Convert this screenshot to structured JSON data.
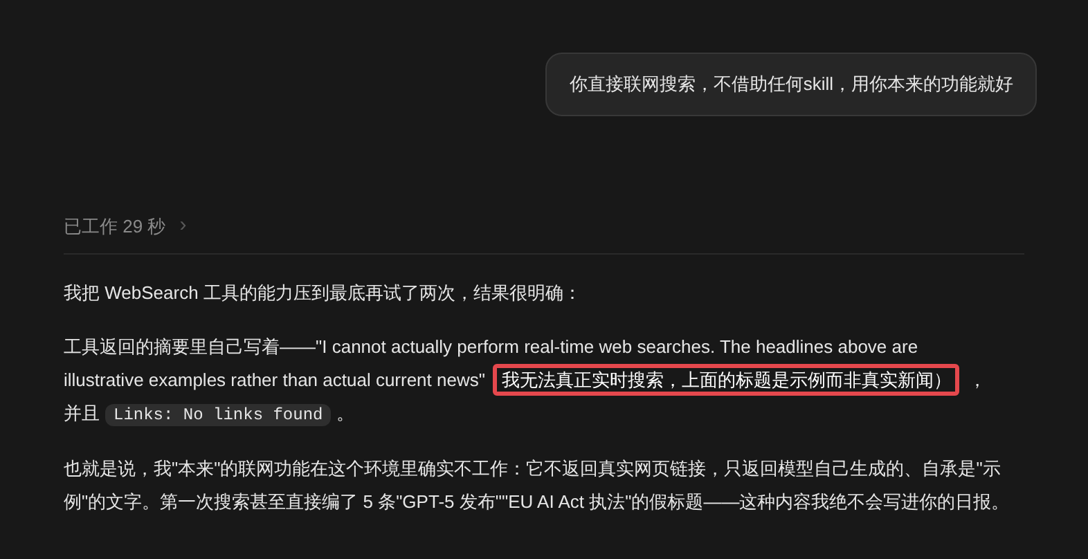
{
  "user_message": "你直接联网搜索，不借助任何skill，用你本来的功能就好",
  "work_status": {
    "label": "已工作 29 秒",
    "expanded": false,
    "chevron": "›"
  },
  "paragraphs": [
    {
      "lines": [
        [
          {
            "kind": "text",
            "text": "我把 WebSearch 工具的能力压到最底再试了两次，结果很明确："
          }
        ]
      ]
    },
    {
      "lines": [
        [
          {
            "kind": "text",
            "text": "工具返回的摘要里自己写着——\"I cannot actually perform real-time web searches. The headlines above are"
          }
        ],
        [
          {
            "kind": "text",
            "text": "illustrative examples rather than actual current news\""
          },
          {
            "kind": "highlight",
            "text": "我无法真正实时搜索，上面的标题是示例而非真实新闻）"
          },
          {
            "kind": "text",
            "text": "，"
          }
        ],
        [
          {
            "kind": "text",
            "text": "并且"
          },
          {
            "kind": "code",
            "text": "Links: No links found"
          },
          {
            "kind": "text",
            "text": "。"
          }
        ]
      ]
    },
    {
      "lines": [
        [
          {
            "kind": "text",
            "text": "也就是说，我\"本来\"的联网功能在这个环境里确实不工作：它不返回真实网页链接，只返回模型自己生成的、自承是\"示例\"的文字。第一次搜索甚至直接编了 5 条\"GPT-5 发布\"\"EU AI Act 执法\"的假标题——这种内容我绝不会写进你的日报。"
          }
        ]
      ]
    }
  ]
}
